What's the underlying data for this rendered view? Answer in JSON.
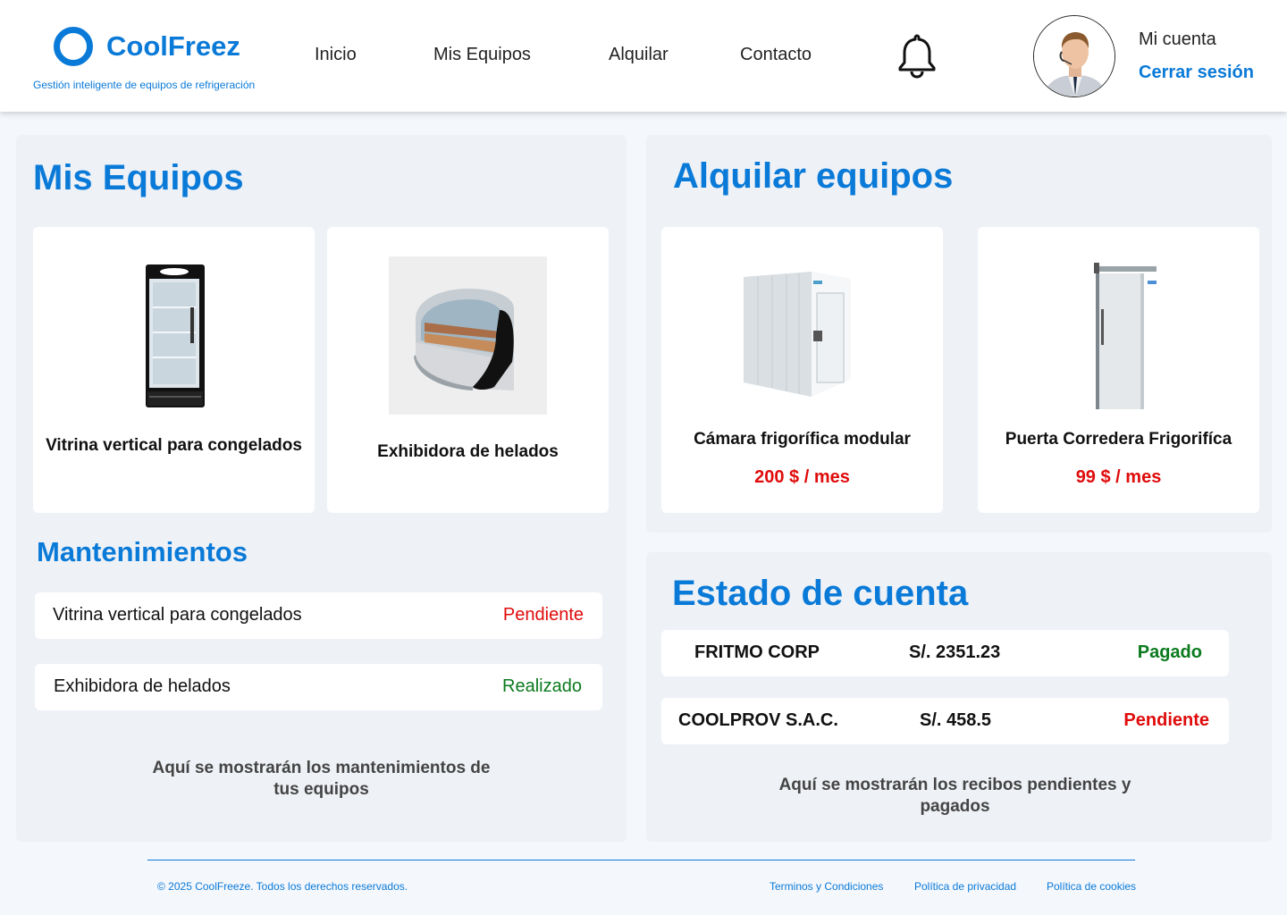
{
  "header": {
    "brand": "CoolFreez",
    "tagline": "Gestión inteligente de equipos de refrigeración",
    "nav": [
      "Inicio",
      "Mis Equipos",
      "Alquilar",
      "Contacto"
    ],
    "account_label": "Mi cuenta",
    "logout_label": "Cerrar sesión"
  },
  "my_equipment": {
    "title": "Mis Equipos",
    "items": [
      {
        "name": "Vitrina vertical para congelados"
      },
      {
        "name": "Exhibidora de helados"
      }
    ]
  },
  "maintenance": {
    "title": "Mantenimientos",
    "rows": [
      {
        "equipment": "Vitrina vertical para congelados",
        "status": "Pendiente",
        "status_color": "#e00b0b"
      },
      {
        "equipment": "Exhibidora de helados",
        "status": "Realizado",
        "status_color": "#0b7a1e"
      }
    ],
    "note": "Aquí se mostrarán los mantenimientos de tus equipos"
  },
  "rent": {
    "title": "Alquilar equipos",
    "items": [
      {
        "name": "Cámara frigorífica modular",
        "price": "200 $ / mes"
      },
      {
        "name": "Puerta Corredera Frigorifíca",
        "price": "99 $ / mes"
      }
    ]
  },
  "account_status": {
    "title": "Estado de cuenta",
    "rows": [
      {
        "company": "FRITMO CORP",
        "amount": "S/. 2351.23",
        "status": "Pagado",
        "status_color": "#0b7a1e"
      },
      {
        "company": "COOLPROV S.A.C.",
        "amount": "S/. 458.5",
        "status": "Pendiente",
        "status_color": "#e00b0b"
      }
    ],
    "note": "Aquí se mostrarán los recibos pendientes y pagados"
  },
  "footer": {
    "copyright": "© 2025 CoolFreeze. Todos los derechos reservados.",
    "links": [
      "Terminos y Condiciones",
      "Política de privacidad",
      "Política de cookies"
    ]
  },
  "colors": {
    "brand": "#0a7ad8",
    "pending": "#e00b0b",
    "done": "#0b7a1e"
  }
}
